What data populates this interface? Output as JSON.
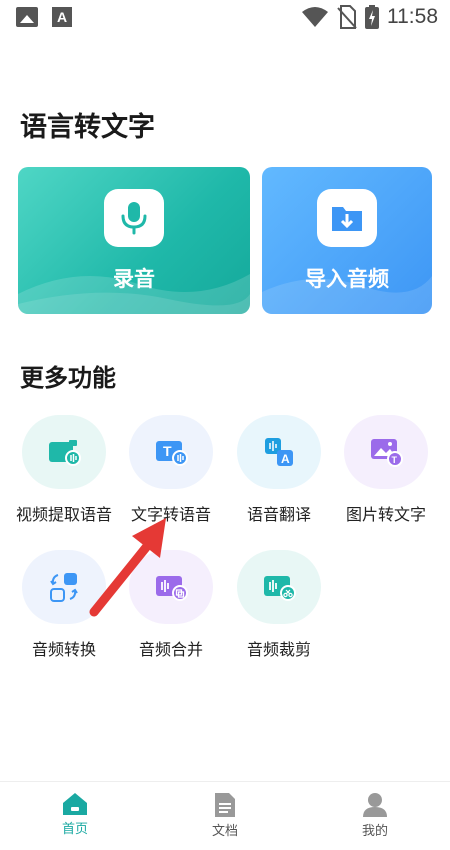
{
  "status_bar": {
    "time": "11:58",
    "icons": [
      "image-icon",
      "font-a-icon",
      "wifi-icon",
      "no-sim-icon",
      "battery-charging-icon"
    ]
  },
  "page_title": "语言转文字",
  "cards": {
    "record": {
      "label": "录音",
      "icon": "microphone-icon"
    },
    "import": {
      "label": "导入音频",
      "icon": "folder-download-icon"
    }
  },
  "more_section": {
    "title": "更多功能"
  },
  "features": [
    {
      "label": "视频提取语音",
      "icon": "video-audio-icon"
    },
    {
      "label": "文字转语音",
      "icon": "text-to-speech-icon"
    },
    {
      "label": "语音翻译",
      "icon": "translate-icon"
    },
    {
      "label": "图片转文字",
      "icon": "image-text-icon"
    },
    {
      "label": "音频转换",
      "icon": "audio-convert-icon"
    },
    {
      "label": "音频合并",
      "icon": "audio-merge-icon"
    },
    {
      "label": "音频裁剪",
      "icon": "audio-cut-icon"
    }
  ],
  "bottom_nav": {
    "home": "首页",
    "docs": "文档",
    "mine": "我的"
  },
  "colors": {
    "teal": "#1fb8a9",
    "blue": "#3d96f5",
    "purple": "#9b6bea",
    "arrow": "#e53935"
  }
}
